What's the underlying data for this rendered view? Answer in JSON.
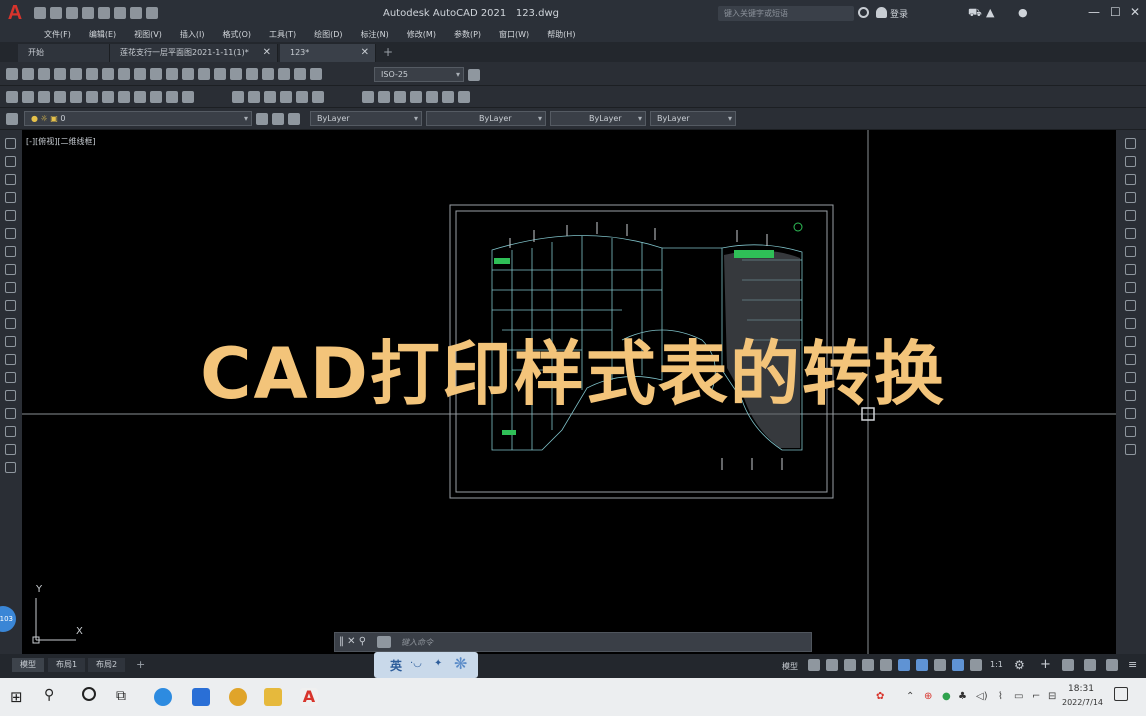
{
  "titlebar": {
    "app_title": "Autodesk AutoCAD 2021",
    "file_name": "123.dwg",
    "search_placeholder": "键入关键字或短语",
    "login_label": "登录"
  },
  "menu": [
    "文件(F)",
    "编辑(E)",
    "视图(V)",
    "插入(I)",
    "格式(O)",
    "工具(T)",
    "绘图(D)",
    "标注(N)",
    "修改(M)",
    "参数(P)",
    "窗口(W)",
    "帮助(H)"
  ],
  "tabs": [
    {
      "label": "开始"
    },
    {
      "label": "莲花支行一层平面图2021-1-11(1)*"
    },
    {
      "label": "123*"
    }
  ],
  "toolbar": {
    "dimstyle": "ISO-25",
    "layer": "0",
    "color": "ByLayer",
    "linetype": "ByLayer",
    "lineweight": "ByLayer",
    "plotstyle": "ByLayer"
  },
  "viewport": {
    "label": "[-][俯视][二维线框]",
    "axis_x": "X",
    "axis_y": "Y"
  },
  "headline": "CAD打印样式表的转换",
  "command": {
    "placeholder": "键入命令"
  },
  "ime": {
    "label": "英"
  },
  "layout_tabs": [
    "模型",
    "布局1",
    "布局2"
  ],
  "status": {
    "model_label": "模型",
    "scale": "1:1"
  },
  "side_badge": "103",
  "clock": {
    "time": "18:31",
    "date": "2022/7/14"
  },
  "colors": {
    "headline": "#f3c47a",
    "canvas": "#000000",
    "drawing_lines": "#7fc2c9"
  }
}
